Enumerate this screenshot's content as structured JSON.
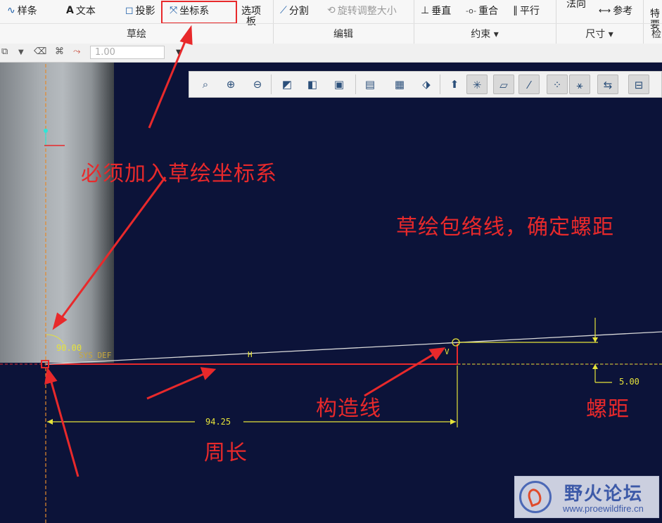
{
  "ribbon": {
    "buttons": [
      {
        "label": "样条",
        "icon": "spline-icon",
        "glyph": "∿",
        "enabled": true
      },
      {
        "label": "文本",
        "icon": "text-icon",
        "glyph": "A",
        "enabled": true
      },
      {
        "label": "投影",
        "icon": "project-icon",
        "glyph": "◻",
        "enabled": true
      },
      {
        "label": "坐标系",
        "icon": "coordinate-system-icon",
        "glyph": "⤧",
        "enabled": true
      },
      {
        "label": "选项板",
        "icon": "palette-icon",
        "glyph": "",
        "enabled": true
      },
      {
        "label": "分割",
        "icon": "divide-icon",
        "glyph": "⟋",
        "enabled": true
      },
      {
        "label": "旋转调整大小",
        "icon": "rotate-resize-icon",
        "glyph": "⟲",
        "enabled": false
      },
      {
        "label": "垂直",
        "icon": "vertical-icon",
        "glyph": "⊥",
        "enabled": true
      },
      {
        "label": "重合",
        "icon": "coincident-icon",
        "glyph": "-o-",
        "enabled": true
      },
      {
        "label": "平行",
        "icon": "parallel-icon",
        "glyph": "∥",
        "enabled": true
      },
      {
        "label": "法向",
        "icon": "normal-icon",
        "glyph": "",
        "enabled": true
      },
      {
        "label": "参考",
        "icon": "reference-icon",
        "glyph": "⟷",
        "enabled": true
      },
      {
        "label": "特\n要",
        "icon": "feature-icon",
        "glyph": "",
        "enabled": true
      }
    ],
    "groups": [
      "草绘",
      "编辑",
      "约束 ▾",
      "尺寸 ▾",
      "检"
    ]
  },
  "toolbar2": {
    "spin_value": "1.00"
  },
  "view_toolbar": {
    "icons": [
      "refit-icon",
      "zoom-in-icon",
      "zoom-out-icon",
      "repaint-icon",
      "shading-icon",
      "saved-views-icon",
      "display-style-icon",
      "view-manager-icon",
      "rotate-center-icon",
      "datum-planes-icon",
      "datum-axes-icon",
      "point-display-icon",
      "csys-display-icon",
      "annotation-display-icon",
      "spin-center-icon",
      "dimension-display-icon",
      "sketch-view-icon"
    ],
    "selected": [
      10,
      11,
      12,
      13,
      14,
      15,
      16
    ]
  },
  "canvas": {
    "angle_dim": "90.00",
    "csys_label": "SYS_DEF",
    "h_label": "H",
    "v_label": "V",
    "length_dim": "94.25",
    "pitch_dim": "5.00"
  },
  "annotations": {
    "csys_note": "必须加入草绘坐标系",
    "envelope_note": "草绘包络线，确定螺距",
    "construction_line": "构造线",
    "pitch": "螺距",
    "perimeter": "周长"
  },
  "watermark": {
    "title": "野火论坛",
    "url": "www.proewildfire.cn"
  },
  "colors": {
    "canvas_bg": "#0c1339",
    "annotation_red": "#e8292b",
    "sketch_yellow": "#e6e33a",
    "sketch_white": "#d9d9d9"
  }
}
